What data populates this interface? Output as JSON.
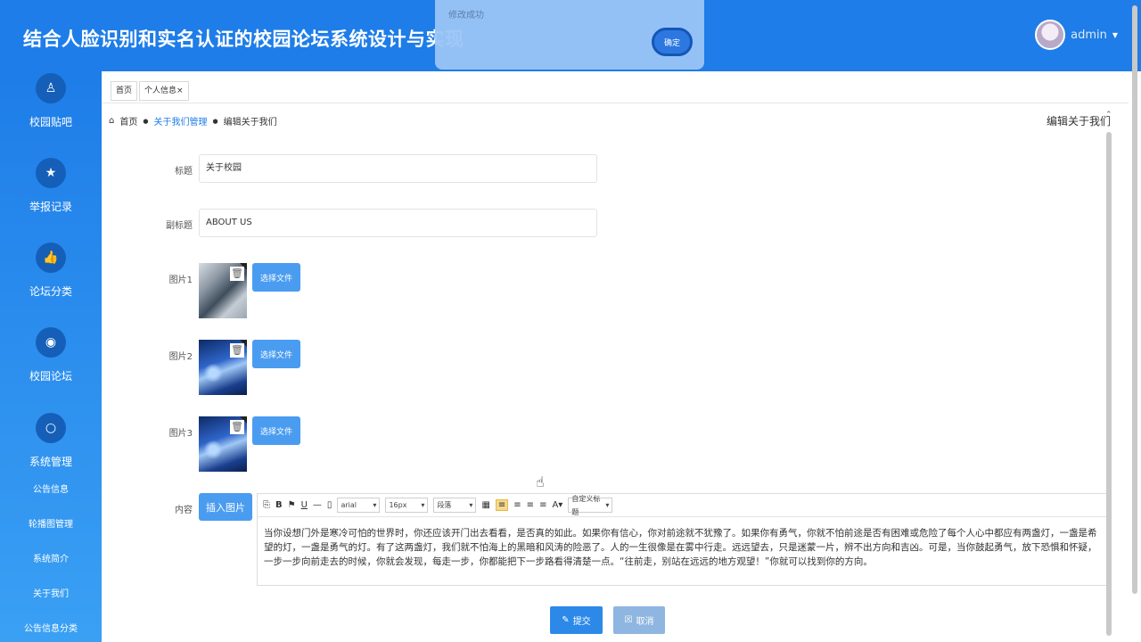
{
  "header": {
    "title": "结合人脸识别和实名认证的校园论坛系统设计与实现",
    "user": "admin"
  },
  "toast": {
    "message": "修改成功",
    "ok": "确定"
  },
  "sidebar": {
    "items": [
      {
        "label": "校园贴吧",
        "icon": "user-icon",
        "glyph": "♙"
      },
      {
        "label": "举报记录",
        "icon": "star-icon",
        "glyph": "★"
      },
      {
        "label": "论坛分类",
        "icon": "thumbs-up-icon",
        "glyph": "👍"
      },
      {
        "label": "校园论坛",
        "icon": "eye-icon",
        "glyph": "◉"
      },
      {
        "label": "系统管理",
        "icon": "search-icon",
        "glyph": "○"
      }
    ],
    "subitems": [
      "公告信息",
      "轮播图管理",
      "系统简介",
      "关于我们",
      "公告信息分类"
    ]
  },
  "tabs": [
    {
      "label": "首页"
    },
    {
      "label": "个人信息×"
    }
  ],
  "breadcrumb": {
    "home": "首页",
    "section": "关于我们管理",
    "current": "编辑关于我们"
  },
  "page_heading": "编辑关于我们",
  "form": {
    "title_label": "标题",
    "title_value": "关于校园",
    "subtitle_label": "副标题",
    "subtitle_value": "ABOUT US",
    "images": [
      {
        "label": "图片1"
      },
      {
        "label": "图片2"
      },
      {
        "label": "图片3"
      }
    ],
    "choose_file": "选择文件",
    "content_label": "内容",
    "insert_image": "插入图片",
    "editor": {
      "font": "arial",
      "size": "16px",
      "paragraph": "段落",
      "custom_title": "自定义标题",
      "content": "当你设想门外是寒冷可怕的世界时，你还应该开门出去看看，是否真的如此。如果你有信心，你对前途就不犹豫了。如果你有勇气，你就不怕前途是否有困难或危险了每个人心中都应有两盏灯，一盏是希望的灯，一盏是勇气的灯。有了这两盏灯，我们就不怕海上的黑暗和风涛的险恶了。人的一生很像是在雾中行走。远远望去，只是迷蒙一片，辨不出方向和吉凶。可是，当你鼓起勇气，放下恐惧和怀疑，一步一步向前走去的时候，你就会发现，每走一步，你都能把下一步路看得清楚一点。“往前走，别站在远远的地方观望！”你就可以找到你的方向。"
    },
    "submit": "提交",
    "cancel": "取消"
  }
}
